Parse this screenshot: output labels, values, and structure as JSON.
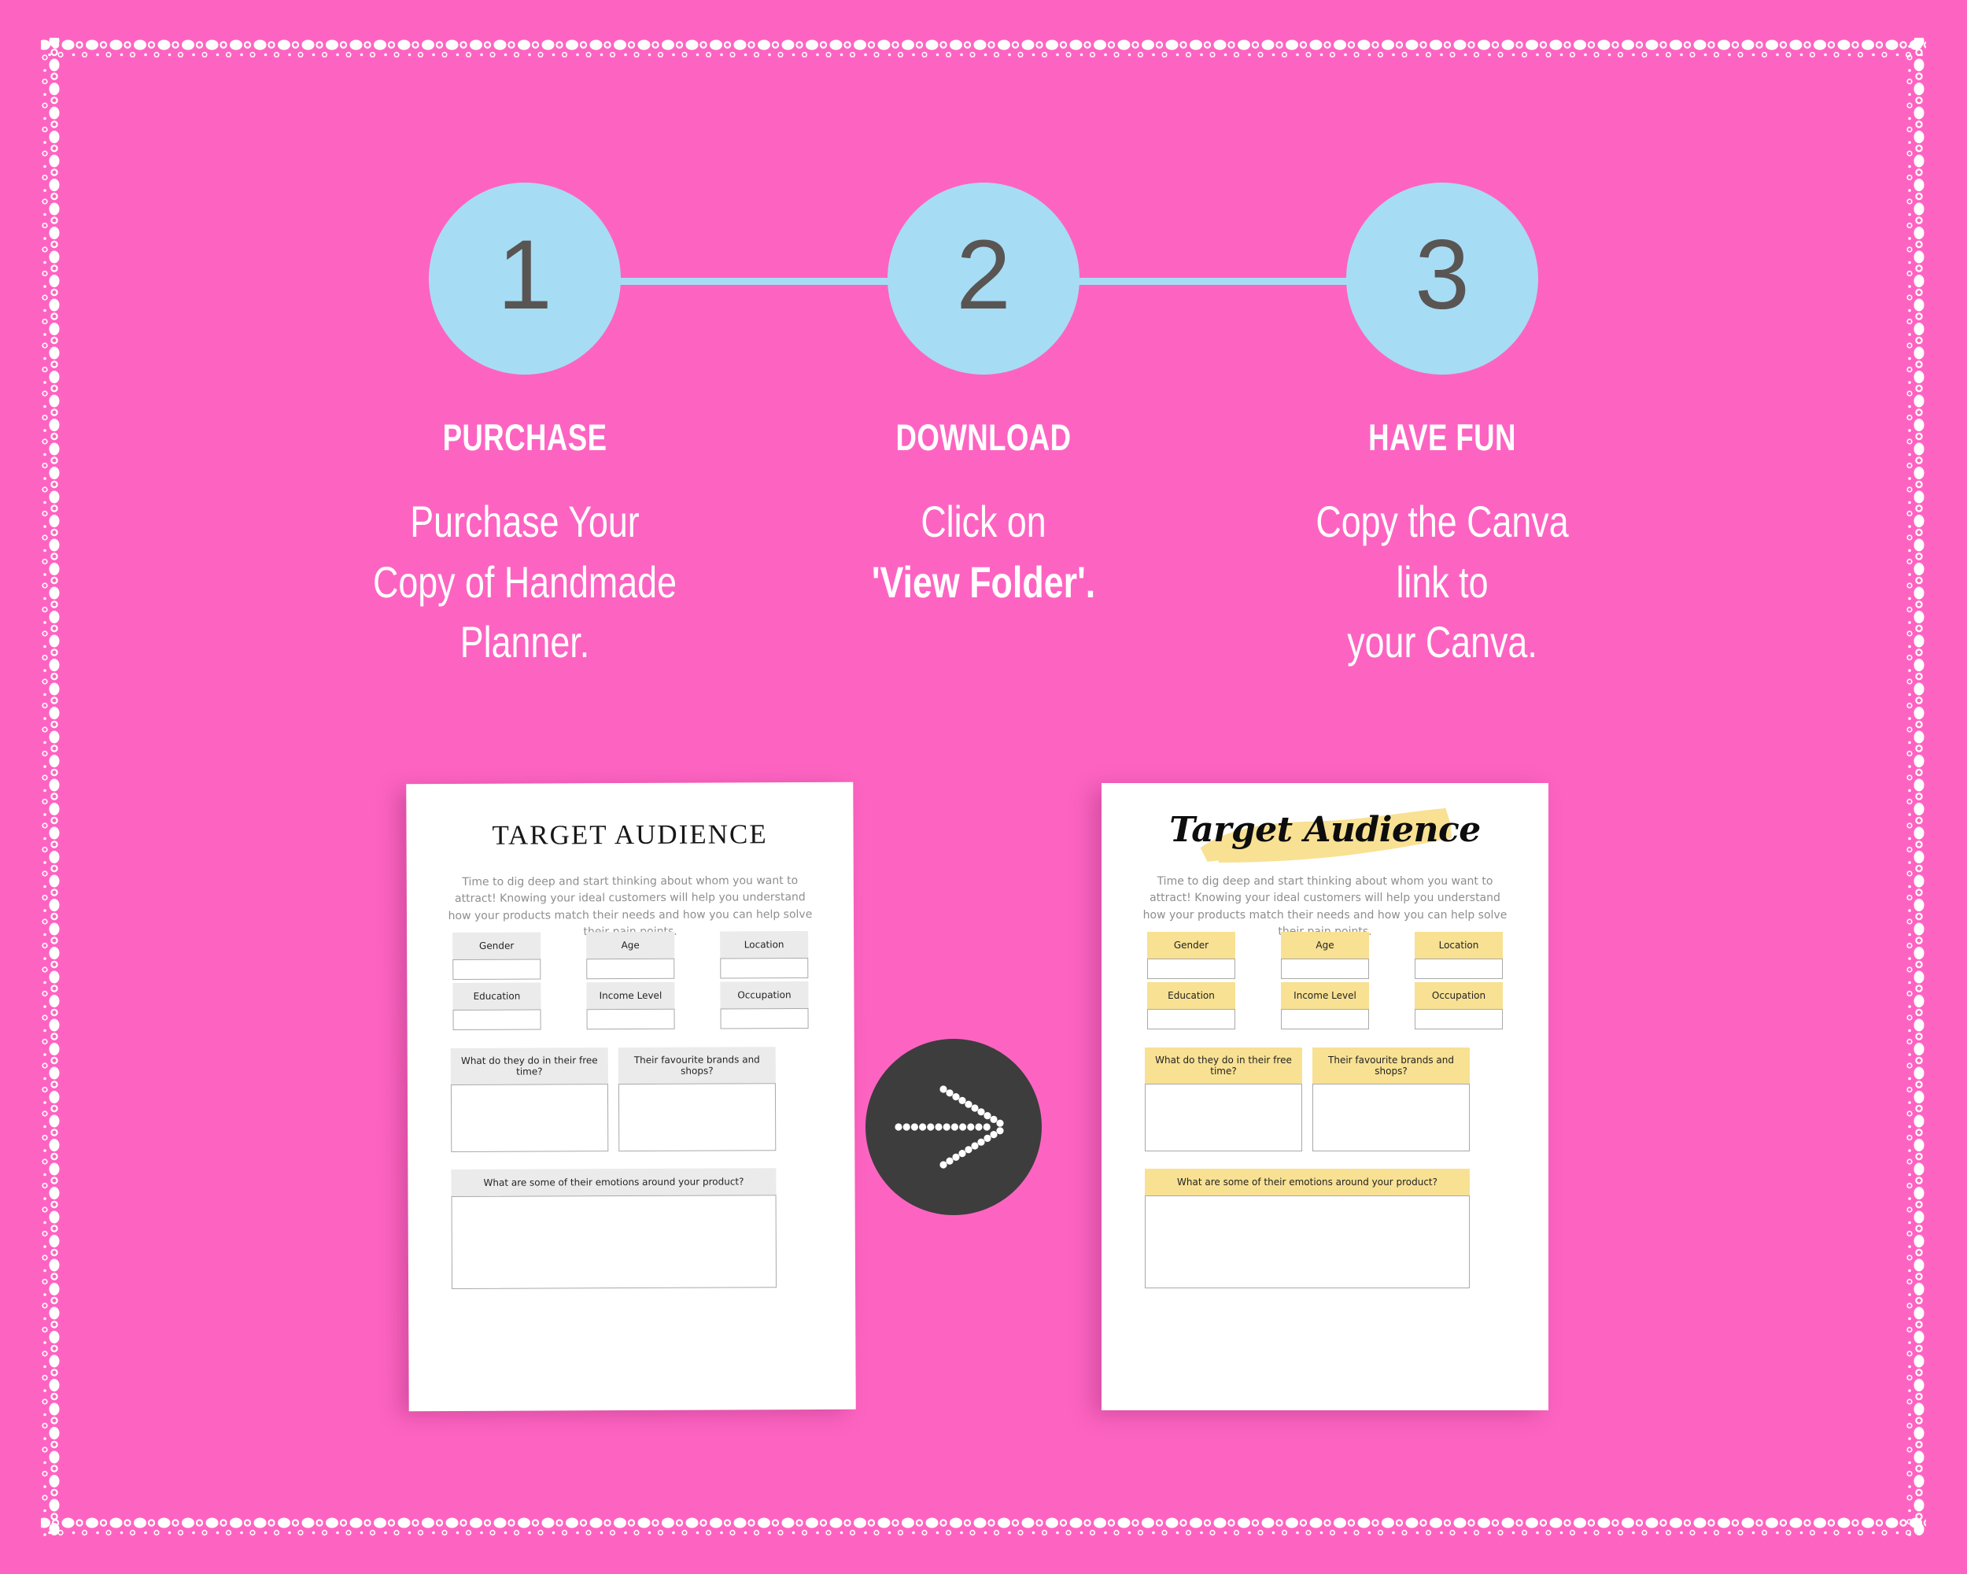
{
  "canvas": {
    "background_color": "#fd64c2",
    "accent_blue": "#a7dcf5",
    "accent_yellow": "#f8e193",
    "accent_gray": "#ebebeb",
    "dark_circle": "#3d3d3d",
    "number_text_color": "#595553"
  },
  "steps": [
    {
      "number": "1",
      "heading": "PURCHASE",
      "lines": [
        {
          "text": "Purchase Your",
          "bold": false
        },
        {
          "text": "Copy of Handmade",
          "bold": false
        },
        {
          "text": "Planner.",
          "bold": false
        }
      ]
    },
    {
      "number": "2",
      "heading": "DOWNLOAD",
      "lines": [
        {
          "text": "Click  on",
          "bold": false
        },
        {
          "text": "'View Folder'.",
          "bold": true
        }
      ]
    },
    {
      "number": "3",
      "heading": "HAVE FUN",
      "lines": [
        {
          "text": "Copy the Canva",
          "bold": false
        },
        {
          "text": "link to",
          "bold": false
        },
        {
          "text": "your Canva.",
          "bold": false
        }
      ]
    }
  ],
  "arrow_button": {
    "icon": "dotted-arrow-right-icon"
  },
  "worksheets": [
    {
      "id": "before",
      "title": "TARGET AUDIENCE",
      "title_style": "serif-caps",
      "header_fill": "#ebebeb",
      "description": "Time to dig deep and start thinking about whom you want to attract! Knowing your ideal customers will help you understand how your products match their needs and how you can help solve their pain points.",
      "small_fields": [
        "Gender",
        "Age",
        "Location",
        "Education",
        "Income Level",
        "Occupation"
      ],
      "medium_fields": [
        "What do they do in their free time?",
        "Their favourite brands and shops?"
      ],
      "wide_field": "What are some of their emotions around your product?"
    },
    {
      "id": "after",
      "title": "Target Audience",
      "title_style": "script-highlight",
      "header_fill": "#f8e193",
      "description": "Time to dig deep and start thinking about whom you want to attract! Knowing your ideal customers will help you understand how your products match their needs and how you can help solve their pain points.",
      "small_fields": [
        "Gender",
        "Age",
        "Location",
        "Education",
        "Income Level",
        "Occupation"
      ],
      "medium_fields": [
        "What do they do in their free time?",
        "Their favourite brands and shops?"
      ],
      "wide_field": "What are some of their emotions around your product?"
    }
  ]
}
